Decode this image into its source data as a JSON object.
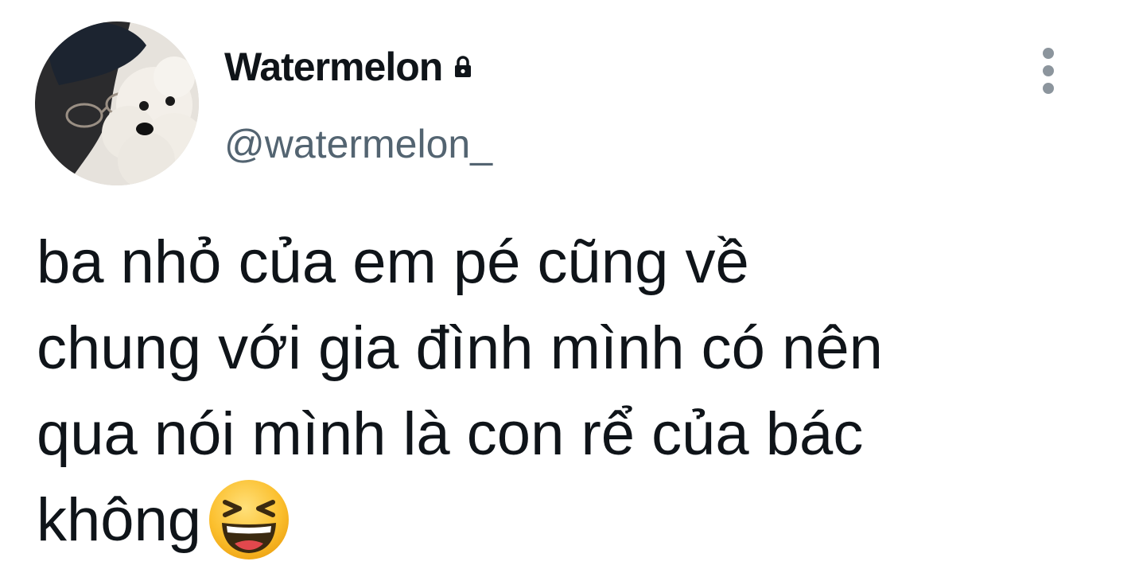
{
  "tweet": {
    "author": {
      "display_name": "Watermelon",
      "handle": "@watermelon_",
      "protected_icon": "lock-icon",
      "avatar": "avatar-photo-person-with-white-poodle"
    },
    "menu_icon": "more-vertical-icon",
    "text_lines": [
      "ba nhỏ của em pé cũng về",
      "chung với gia đình mình có nên",
      "qua nói mình là con rể của bác",
      "không"
    ],
    "emoji": "grinning-squinting-face-emoji"
  },
  "colors": {
    "text_primary": "#0f1419",
    "text_secondary": "#536471",
    "icon_gray": "#8c959d",
    "emoji_yellow": "#fbbf2d"
  }
}
